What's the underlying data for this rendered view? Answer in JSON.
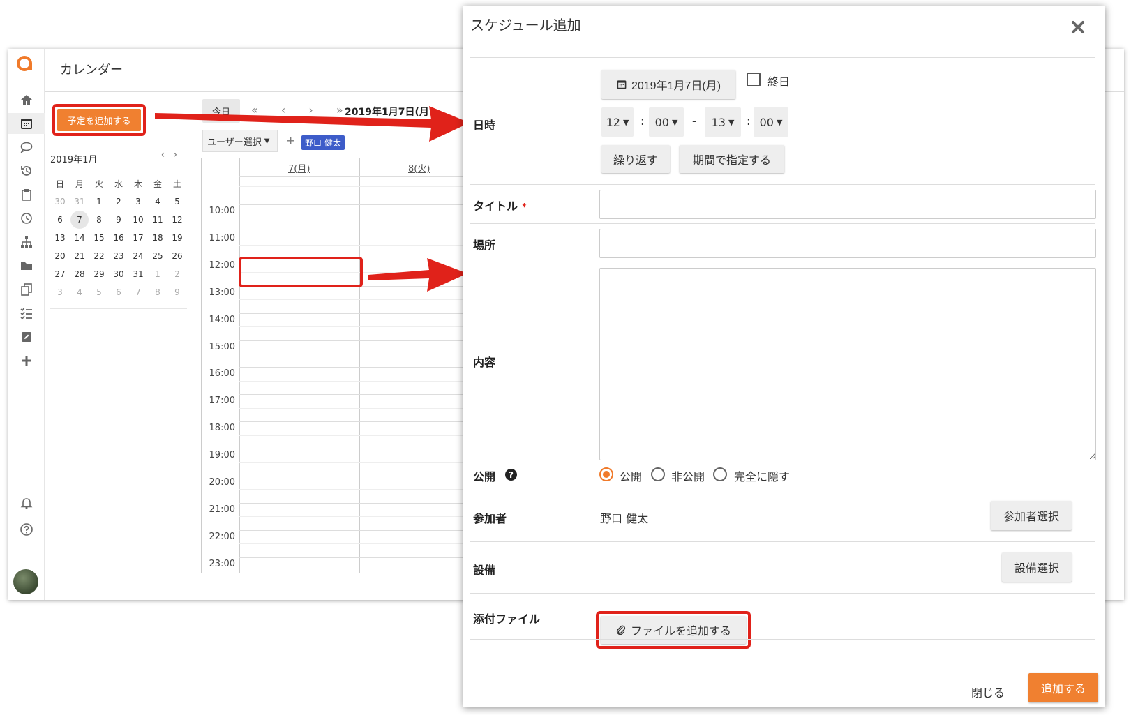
{
  "app": {
    "page_title": "カレンダー",
    "sidebar_icons": [
      "home-icon",
      "calendar-icon",
      "chat-icon",
      "history-icon",
      "clipboard-icon",
      "clock-icon",
      "org-chart-icon",
      "folder-icon",
      "copy-icon",
      "checklist-icon",
      "edit-icon",
      "plus-icon"
    ],
    "bottom_icons": [
      "bell-icon",
      "help-icon"
    ]
  },
  "left_panel": {
    "add_event_label": "予定を追加する",
    "mini_calendar": {
      "month_label": "2019年1月",
      "prev": "‹",
      "next": "›",
      "weekdays": [
        "日",
        "月",
        "火",
        "水",
        "木",
        "金",
        "土"
      ],
      "weeks": [
        [
          "30",
          "31",
          "1",
          "2",
          "3",
          "4",
          "5"
        ],
        [
          "6",
          "7",
          "8",
          "9",
          "10",
          "11",
          "12"
        ],
        [
          "13",
          "14",
          "15",
          "16",
          "17",
          "18",
          "19"
        ],
        [
          "20",
          "21",
          "22",
          "23",
          "24",
          "25",
          "26"
        ],
        [
          "27",
          "28",
          "29",
          "30",
          "31",
          "1",
          "2"
        ],
        [
          "3",
          "4",
          "5",
          "6",
          "7",
          "8",
          "9"
        ]
      ],
      "today": "7"
    }
  },
  "calendar": {
    "today_label": "今日",
    "nav": "« ‹ › »",
    "date_label": "2019年1月7日(月",
    "user_select_label": "ユーザー選択",
    "user_add": "+",
    "user_tag": "野口 健太",
    "columns": [
      "7(月)",
      "8(火)"
    ],
    "times": [
      "10:00",
      "11:00",
      "12:00",
      "13:00",
      "14:00",
      "15:00",
      "16:00",
      "17:00",
      "18:00",
      "19:00",
      "20:00",
      "21:00",
      "22:00",
      "23:00"
    ]
  },
  "modal": {
    "title": "スケジュール追加",
    "close_icon": "close-icon",
    "date_label": "日時",
    "date_value": "2019年1月7日(月)",
    "all_day_label": "終日",
    "start_hour": "12",
    "start_minute": "00",
    "time_dash": "-",
    "end_hour": "13",
    "end_minute": "00",
    "colon": ":",
    "repeat_label": "繰り返す",
    "range_label": "期間で指定する",
    "title_label": "タイトル",
    "required_mark": "*",
    "place_label": "場所",
    "content_label": "内容",
    "visibility_label": "公開",
    "visibility_options": [
      "公開",
      "非公開",
      "完全に隠す"
    ],
    "visibility_selected": "公開",
    "participants_label": "参加者",
    "participants_value": "野口 健太",
    "participants_button": "参加者選択",
    "equipment_label": "設備",
    "equipment_button": "設備選択",
    "attachment_label": "添付ファイル",
    "attachment_button": "ファイルを追加する",
    "close_label": "閉じる",
    "submit_label": "追加する"
  },
  "colors": {
    "accent": "#f08030",
    "highlight_red": "#e0221a",
    "user_tag": "#3d5cc9"
  }
}
